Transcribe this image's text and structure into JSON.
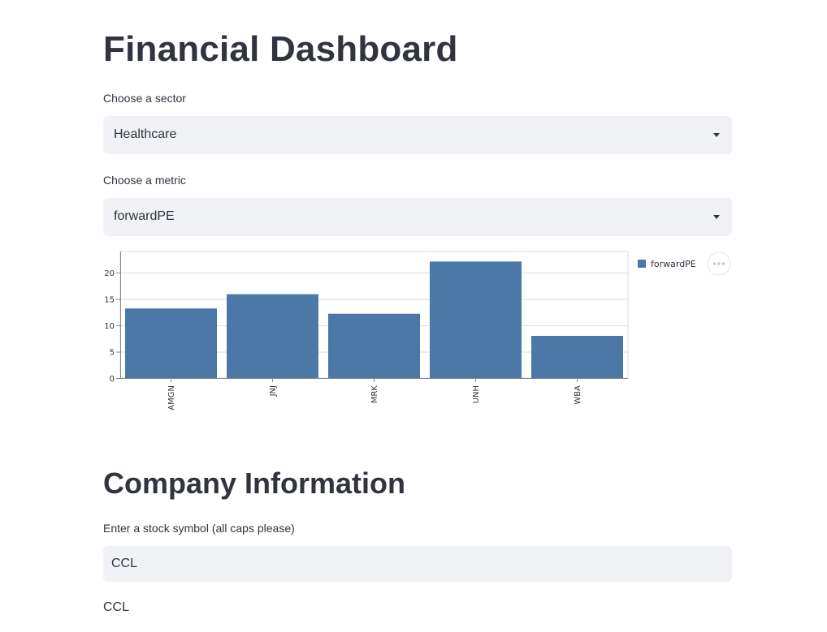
{
  "page": {
    "title": "Financial Dashboard"
  },
  "sector_select": {
    "label": "Choose a sector",
    "value": "Healthcare"
  },
  "metric_select": {
    "label": "Choose a metric",
    "value": "forwardPE"
  },
  "chart_data": {
    "type": "bar",
    "categories": [
      "AMGN",
      "JNJ",
      "MRK",
      "UNH",
      "WBA"
    ],
    "series": [
      {
        "name": "forwardPE",
        "values": [
          13.2,
          15.9,
          12.2,
          22.1,
          8.0
        ]
      }
    ],
    "ylim": [
      0,
      24
    ],
    "yticks": [
      0,
      5,
      10,
      15,
      20
    ],
    "grid": true,
    "legend": "right",
    "color": "#4c78a8"
  },
  "company_section": {
    "title": "Company Information",
    "input_label": "Enter a stock symbol (all caps please)",
    "input_value": "CCL",
    "output": "CCL"
  },
  "colors": {
    "background": "#ffffff",
    "text": "#31333f",
    "input_bg": "#f0f2f6",
    "bar": "#4c78a8",
    "grid": "#dddddd",
    "axis": "#888888"
  }
}
